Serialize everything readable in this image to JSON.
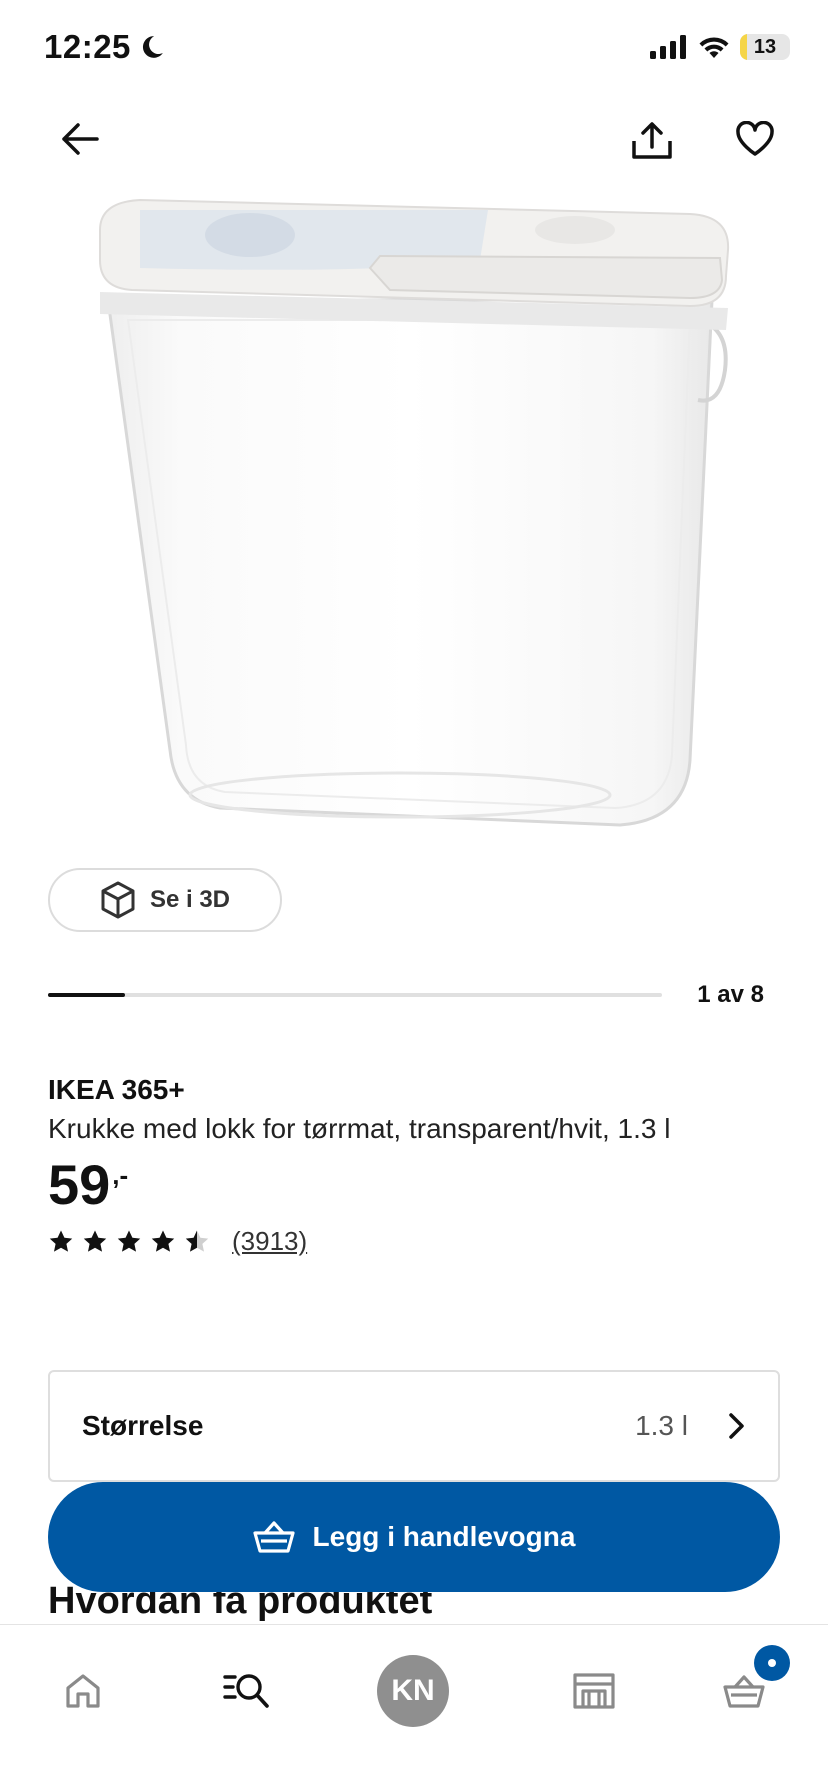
{
  "status_bar": {
    "time": "12:25",
    "battery": "13",
    "battery_level": 0.13,
    "icons": [
      "moon-icon",
      "signal-icon",
      "wifi-icon",
      "battery-icon"
    ]
  },
  "header": {
    "icons": [
      "back-arrow-icon",
      "share-icon",
      "heart-icon"
    ]
  },
  "gallery": {
    "view_3d_label": "Se i 3D",
    "counter": "1 av 8",
    "progress": 0.125
  },
  "product": {
    "brand": "IKEA 365+",
    "description": "Krukke med lokk for tørrmat, transparent/hvit, 1.3 l",
    "price_main": "59",
    "price_suffix": ",-",
    "rating": 4.5,
    "rating_max": 5,
    "review_count": "(3913)"
  },
  "size": {
    "label": "Størrelse",
    "value": "1.3 l"
  },
  "cta": {
    "add_to_cart_label": "Legg i handlevogna",
    "color": "#0058a3"
  },
  "section": {
    "heading": "Hvordan få produktet"
  },
  "tab_bar": {
    "avatar_initials": "KN",
    "icons": [
      "home-icon",
      "search-list-icon",
      "store-icon",
      "cart-icon"
    ]
  }
}
